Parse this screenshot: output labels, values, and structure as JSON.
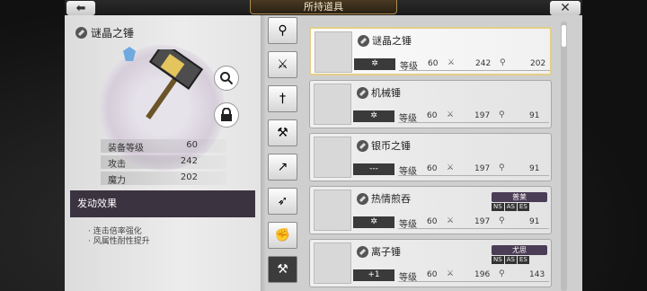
{
  "header": {
    "title": "所持道具",
    "back_label": "⬅",
    "close_label": "✕"
  },
  "detail": {
    "weapon_name": "谜晶之锤",
    "stats": [
      {
        "label": "装备等级",
        "value": "60"
      },
      {
        "label": "攻击",
        "value": "242"
      },
      {
        "label": "魔力",
        "value": "202"
      }
    ],
    "effect_title": "发动效果",
    "effects": [
      "· 连击倍率强化",
      "· 风属性耐性提升"
    ]
  },
  "tabs": [
    "staff-icon",
    "sword-icon",
    "dagger-icon",
    "axe-icon",
    "spear-icon",
    "bow-icon",
    "fist-icon",
    "hammer-icon"
  ],
  "list": {
    "level_label": "等级",
    "items": [
      {
        "name": "谜晶之锤",
        "rank": "✲",
        "level": "60",
        "atk": "242",
        "mag": "202",
        "selected": true,
        "character": "",
        "tags": []
      },
      {
        "name": "机械锤",
        "rank": "✲",
        "level": "60",
        "atk": "197",
        "mag": "91",
        "selected": false,
        "character": "",
        "tags": []
      },
      {
        "name": "银币之锤",
        "rank": "---",
        "level": "60",
        "atk": "197",
        "mag": "91",
        "selected": false,
        "character": "",
        "tags": []
      },
      {
        "name": "热情煎吞",
        "rank": "✲",
        "level": "60",
        "atk": "197",
        "mag": "91",
        "selected": false,
        "character": "普莱",
        "tags": [
          "NS",
          "AS",
          "ES"
        ]
      },
      {
        "name": "离子锤",
        "rank": "+1",
        "level": "60",
        "atk": "196",
        "mag": "143",
        "selected": false,
        "character": "尤思",
        "tags": [
          "NS",
          "AS",
          "ES"
        ]
      }
    ]
  },
  "colors": {
    "selected_border": "#e2cf86",
    "effect_head_bg": "#3b3340",
    "char_badge_bg": "#4a3d55"
  }
}
